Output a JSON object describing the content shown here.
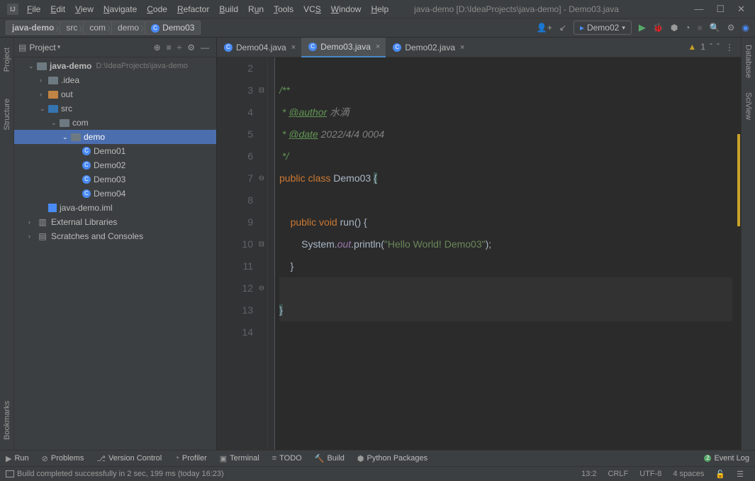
{
  "window": {
    "title": "java-demo [D:\\IdeaProjects\\java-demo] - Demo03.java"
  },
  "menu": [
    "File",
    "Edit",
    "View",
    "Navigate",
    "Code",
    "Refactor",
    "Build",
    "Run",
    "Tools",
    "VCS",
    "Window",
    "Help"
  ],
  "breadcrumb": [
    "java-demo",
    "src",
    "com",
    "demo",
    "Demo03"
  ],
  "runconfig": {
    "name": "Demo02"
  },
  "projectPanel": {
    "title": "Project"
  },
  "tree": {
    "root": {
      "name": "java-demo",
      "hint": "D:\\IdeaProjects\\java-demo"
    },
    "idea": ".idea",
    "out": "out",
    "src": "src",
    "com": "com",
    "demo": "demo",
    "files": [
      "Demo01",
      "Demo02",
      "Demo03",
      "Demo04"
    ],
    "iml": "java-demo.iml",
    "extlib": "External Libraries",
    "scratch": "Scratches and Consoles"
  },
  "tabs": [
    {
      "label": "Demo04.java",
      "active": false
    },
    {
      "label": "Demo03.java",
      "active": true
    },
    {
      "label": "Demo02.java",
      "active": false
    }
  ],
  "editor": {
    "warningCount": "1",
    "lines": {
      "l2": "",
      "l3": "/**",
      "l4_prefix": " * ",
      "l4_tag": "@author",
      "l4_rest": " 水滴",
      "l5_prefix": " * ",
      "l5_tag": "@date",
      "l5_rest": " 2022/4/4 0004",
      "l6": " */",
      "l7_kw1": "public ",
      "l7_kw2": "class ",
      "l7_cls": "Demo03 ",
      "l7_br": "{",
      "l8": "",
      "l9_indent": "    ",
      "l9_kw1": "public ",
      "l9_kw2": "void ",
      "l9_name": "run",
      "l9_rest": "() {",
      "l10_indent": "        ",
      "l10_sys": "System.",
      "l10_out": "out",
      "l10_dot": ".println(",
      "l10_str": "\"Hello World! Demo03\"",
      "l10_end": ");",
      "l11": "    }",
      "l12": "",
      "l13": "}",
      "l14": ""
    },
    "lineNumbers": [
      "2",
      "3",
      "4",
      "5",
      "6",
      "7",
      "8",
      "9",
      "10",
      "11",
      "12",
      "13",
      "14"
    ]
  },
  "leftGutter": {
    "project": "Project",
    "structure": "Structure",
    "bookmarks": "Bookmarks"
  },
  "rightGutter": {
    "db": "Database",
    "sci": "SciView"
  },
  "bottomTools": {
    "run": "Run",
    "problems": "Problems",
    "vcs": "Version Control",
    "profiler": "Profiler",
    "terminal": "Terminal",
    "todo": "TODO",
    "build": "Build",
    "python": "Python Packages",
    "eventlog": "Event Log"
  },
  "status": {
    "msg": "Build completed successfully in 2 sec, 199 ms (today 16:23)",
    "pos": "13:2",
    "eol": "CRLF",
    "enc": "UTF-8",
    "indent": "4 spaces"
  }
}
